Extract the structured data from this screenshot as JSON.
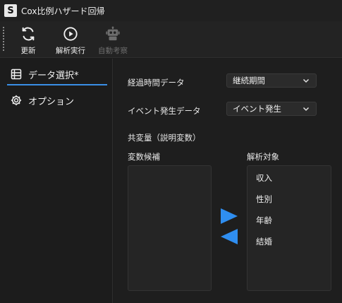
{
  "window": {
    "app_icon_letter": "S",
    "title": "Cox比例ハザード回帰"
  },
  "toolbar": {
    "refresh_label": "更新",
    "run_label": "解析実行",
    "auto_label": "自動考察"
  },
  "sidebar": {
    "items": [
      {
        "label": "データ選択*",
        "icon": "table-icon",
        "active": true
      },
      {
        "label": "オプション",
        "icon": "gear-icon",
        "active": false
      }
    ]
  },
  "form": {
    "duration_label": "経過時間データ",
    "duration_value": "継続期間",
    "event_label": "イベント発生データ",
    "event_value": "イベント発生",
    "covariates_label": "共変量（説明変数）",
    "candidates_label": "変数候補",
    "targets_label": "解析対象",
    "candidates": [],
    "targets": [
      "収入",
      "性別",
      "年齢",
      "結婚"
    ]
  },
  "colors": {
    "accent": "#3a8ee6",
    "arrow": "#2f8ef0"
  }
}
